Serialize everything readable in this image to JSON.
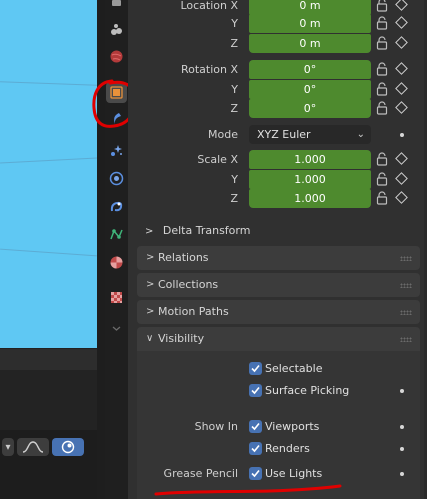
{
  "transform": {
    "location": {
      "label_x": "Location X",
      "label_y": "Y",
      "label_z": "Z",
      "x": "0 m",
      "y": "0 m",
      "z": "0 m"
    },
    "rotation": {
      "label_x": "Rotation X",
      "label_y": "Y",
      "label_z": "Z",
      "x": "0°",
      "y": "0°",
      "z": "0°"
    },
    "mode": {
      "label": "Mode",
      "value": "XYZ Euler"
    },
    "scale": {
      "label_x": "Scale X",
      "label_y": "Y",
      "label_z": "Z",
      "x": "1.000",
      "y": "1.000",
      "z": "1.000"
    },
    "delta_transform": "Delta Transform"
  },
  "panels": {
    "relations": "Relations",
    "collections": "Collections",
    "motion_paths": "Motion Paths",
    "visibility": "Visibility"
  },
  "visibility": {
    "selectable": "Selectable",
    "surface_picking": "Surface Picking",
    "show_in_label": "Show In",
    "viewports": "Viewports",
    "renders": "Renders",
    "grease_pencil_label": "Grease Pencil",
    "use_lights": "Use Lights"
  },
  "colors": {
    "field_green": "#4e8a2e",
    "checkbox_blue": "#4772b3",
    "annotation_red": "#e00000",
    "viewport_sky": "#5fc8f3"
  },
  "icons": {
    "tabs": [
      "tool-icon",
      "physics-icon",
      "world-icon",
      "object-icon",
      "modifier-icon",
      "particles-icon",
      "physics-circle-icon",
      "constraints-icon",
      "object-data-icon",
      "material-icon",
      "texture-icon"
    ]
  }
}
